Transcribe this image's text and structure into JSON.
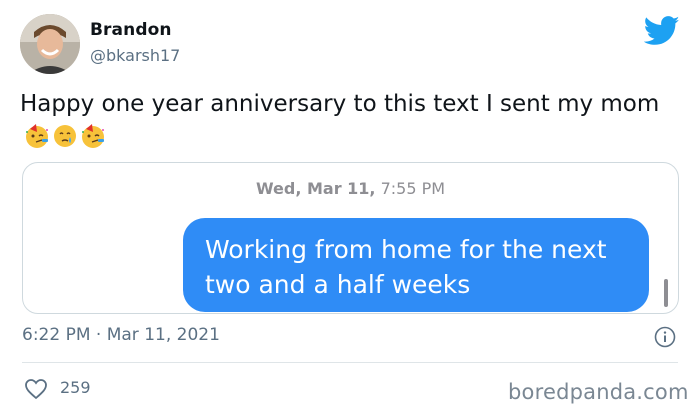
{
  "author": {
    "name": "Brandon",
    "handle": "@bkarsh17",
    "avatar_icon": "profile-photo"
  },
  "tweet": {
    "text": "Happy one year anniversary to this text I sent my mom",
    "emojis": [
      "partying-face-emoji",
      "face-holding-back-tears-emoji",
      "partying-face-emoji"
    ]
  },
  "message_card": {
    "date_prefix": "Wed, Mar 11,",
    "time": "7:55 PM",
    "bubble_text": "Working from home for the next two and a half weeks",
    "bubble_color": "#2f8cf6"
  },
  "meta": {
    "timestamp": "6:22 PM · Mar 11, 2021",
    "likes": "259"
  },
  "watermark": "boredpanda.com",
  "colors": {
    "twitter_blue": "#1da1f2",
    "secondary_text": "#5b7083"
  }
}
